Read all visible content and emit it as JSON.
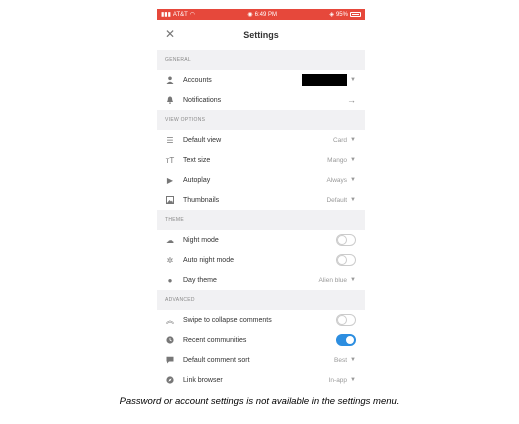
{
  "status_bar": {
    "carrier": "AT&T",
    "time": "6:49 PM",
    "battery": "95%"
  },
  "header": {
    "title": "Settings",
    "close_icon": "close-icon"
  },
  "sections": {
    "general": "GENERAL",
    "view_options": "VIEW OPTIONS",
    "theme": "THEME",
    "advanced": "ADVANCED"
  },
  "rows": {
    "accounts": {
      "label": "Accounts",
      "icon": "person-icon"
    },
    "notifications": {
      "label": "Notifications",
      "icon": "bell-icon"
    },
    "default_view": {
      "label": "Default view",
      "value": "Card",
      "icon": "list-icon"
    },
    "text_size": {
      "label": "Text size",
      "value": "Mango",
      "icon": "text-size-icon"
    },
    "autoplay": {
      "label": "Autoplay",
      "value": "Always",
      "icon": "play-icon"
    },
    "thumbnails": {
      "label": "Thumbnails",
      "value": "Default",
      "icon": "image-icon"
    },
    "night_mode": {
      "label": "Night mode",
      "on": false,
      "icon": "night-mode-icon"
    },
    "auto_night_mode": {
      "label": "Auto night mode",
      "on": false,
      "icon": "gear-icon"
    },
    "day_theme": {
      "label": "Day theme",
      "value": "Alien blue",
      "icon": "circle-icon"
    },
    "swipe_collapse": {
      "label": "Swipe to collapse comments",
      "on": false,
      "icon": "double-chevron-up-icon"
    },
    "recent_communities": {
      "label": "Recent communities",
      "on": true,
      "icon": "clock-icon"
    },
    "default_comment_sort": {
      "label": "Default comment sort",
      "value": "Best",
      "icon": "comment-icon"
    },
    "link_browser": {
      "label": "Link browser",
      "value": "In-app",
      "icon": "compass-icon"
    }
  },
  "colors": {
    "status_bar": "#e6483b",
    "toggle_on": "#2d8ee0",
    "section_bg": "#f1f1f3"
  },
  "caption": "Password or account settings is not available in the settings menu."
}
